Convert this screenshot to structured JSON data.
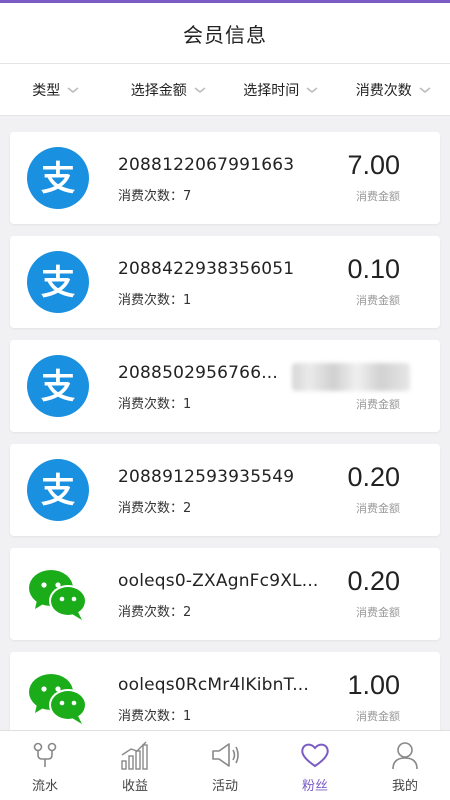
{
  "header": {
    "title": "会员信息"
  },
  "filters": [
    {
      "label": "类型"
    },
    {
      "label": "选择金额"
    },
    {
      "label": "选择时间"
    },
    {
      "label": "消费次数"
    }
  ],
  "colors": {
    "accent": "#7b5cc4",
    "alipay_blue": "#1a90e0",
    "wechat_green": "#1aad19"
  },
  "records": [
    {
      "type": "alipay-icon",
      "account": "2088122067991663",
      "count_label": "消费次数：7",
      "amount": "7.00",
      "amount_label": "消费金额"
    },
    {
      "type": "alipay-icon",
      "account": "2088422938356051",
      "count_label": "消费次数：1",
      "amount": "0.10",
      "amount_label": "消费金额"
    },
    {
      "type": "alipay-icon",
      "account": "2088502956766...",
      "count_label": "消费次数：1",
      "amount": "",
      "amount_label": "消费金额"
    },
    {
      "type": "alipay-icon",
      "account": "2088912593935549",
      "count_label": "消费次数：2",
      "amount": "0.20",
      "amount_label": "消费金额"
    },
    {
      "type": "wechat-icon",
      "account": "ooleqs0-ZXAgnFc9XL...",
      "count_label": "消费次数：2",
      "amount": "0.20",
      "amount_label": "消费金额"
    },
    {
      "type": "wechat-icon",
      "account": "ooleqs0RcMr4lKibnT...",
      "count_label": "消费次数：1",
      "amount": "1.00",
      "amount_label": "消费金额"
    }
  ],
  "tabbar": [
    {
      "label": "流水",
      "icon": "flow-icon",
      "active": false
    },
    {
      "label": "收益",
      "icon": "bar-chart-icon",
      "active": false
    },
    {
      "label": "活动",
      "icon": "megaphone-icon",
      "active": false
    },
    {
      "label": "粉丝",
      "icon": "heart-icon",
      "active": true
    },
    {
      "label": "我的",
      "icon": "user-icon",
      "active": false
    }
  ]
}
